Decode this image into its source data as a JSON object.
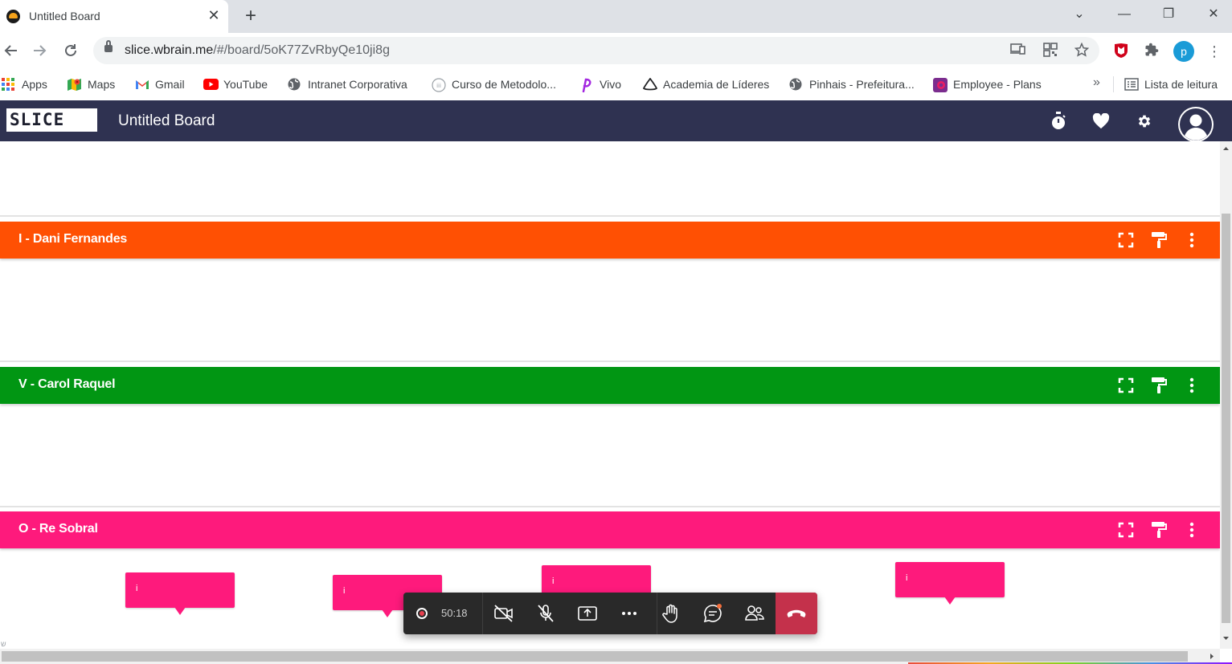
{
  "browser": {
    "tab_title": "Untitled Board",
    "tab_close": "✕",
    "new_tab": "+",
    "url_host": "slice.wbrain.me",
    "url_path": "/#/board/5oK77ZvRbyQe10ji8g",
    "profile_initial": "p",
    "window_controls": {
      "minimize": "—",
      "restore": "❐",
      "close": "✕",
      "dropdown": "⌄"
    },
    "bookmarks": [
      {
        "label": "Apps",
        "icon": "apps-grid-icon"
      },
      {
        "label": "Maps",
        "icon": "maps-icon"
      },
      {
        "label": "Gmail",
        "icon": "gmail-icon"
      },
      {
        "label": "YouTube",
        "icon": "youtube-icon"
      },
      {
        "label": "Intranet Corporativa",
        "icon": "globe-icon"
      },
      {
        "label": "Curso de Metodolo...",
        "icon": "course-icon"
      },
      {
        "label": "Vivo",
        "icon": "vivo-icon"
      },
      {
        "label": "Academia de Líderes",
        "icon": "academia-icon"
      },
      {
        "label": "Pinhais - Prefeitura...",
        "icon": "globe-icon"
      },
      {
        "label": "Employee - Plans",
        "icon": "employee-icon"
      }
    ],
    "bookmarks_more": "»",
    "reading_list": "Lista de leitura"
  },
  "app": {
    "logo_text": "SLICE",
    "board_title": "Untitled Board",
    "header_icons": [
      "timer-icon",
      "heart-icon",
      "gear-icon",
      "user-avatar-icon"
    ]
  },
  "rows": [
    {
      "title": "I - Dani Fernandes",
      "color": "#ff5003"
    },
    {
      "title": "V - Carol Raquel",
      "color": "#019613"
    },
    {
      "title": "O - Re Sobral",
      "color": "#fe1a7c"
    }
  ],
  "notes": [
    {
      "text": "i",
      "color": "#fe1a7c"
    },
    {
      "text": "i",
      "color": "#fe1a7c"
    },
    {
      "text": "i",
      "color": "#fe1a7c"
    },
    {
      "text": "i",
      "color": "#fe1a7c"
    }
  ],
  "call_bar": {
    "timer": "50:18",
    "buttons": [
      "record-icon",
      "camera-off-icon",
      "mic-off-icon",
      "share-screen-icon",
      "more-icon",
      "raise-hand-icon",
      "chat-icon",
      "participants-icon",
      "hang-up-icon"
    ],
    "hangup_color": "#c4314b"
  },
  "scrollbar_corner_text": "ש"
}
